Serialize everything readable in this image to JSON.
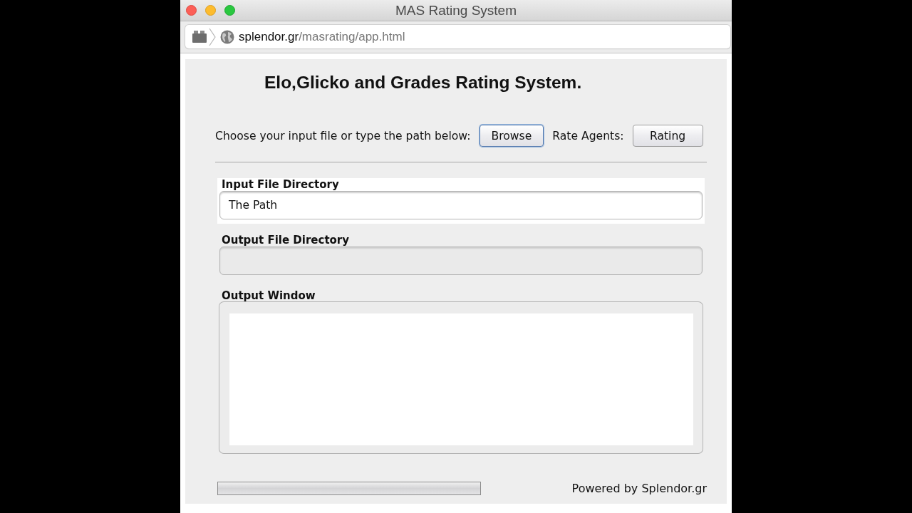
{
  "window": {
    "title": "MAS Rating System"
  },
  "address_bar": {
    "domain": "splendor.gr",
    "path": "/masrating/app.html"
  },
  "applet": {
    "heading": "Elo,Glicko and Grades Rating System.",
    "toolbar": [
      {
        "kind": "label",
        "text": "Choose your input file or type the path below:"
      },
      {
        "kind": "button",
        "text": "Browse",
        "focused": true
      },
      {
        "kind": "label",
        "text": "Rate Agents:"
      },
      {
        "kind": "button",
        "text": "Rating",
        "focused": false
      }
    ],
    "fields": [
      {
        "kind": "line",
        "label": "Input File Directory",
        "value": "The Path",
        "highlighted": true,
        "disabled": false
      },
      {
        "kind": "line",
        "label": "Output File Directory",
        "highlighted": false,
        "disabled": true
      },
      {
        "kind": "area",
        "label": "Output Window",
        "highlighted": false,
        "disabled": false
      }
    ],
    "progress": {
      "level": 0
    },
    "footer": "Powered by Splendor.gr"
  }
}
